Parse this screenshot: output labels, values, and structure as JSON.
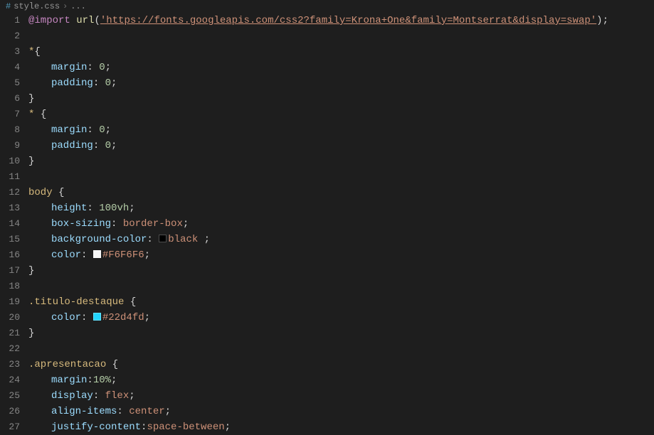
{
  "tab": {
    "filename": "style.css",
    "separator": "›",
    "crumb": "..."
  },
  "lines": [
    {
      "num": "1",
      "segments": [
        {
          "cls": "at-rule",
          "text": "@import"
        },
        {
          "cls": "",
          "text": " "
        },
        {
          "cls": "func",
          "text": "url"
        },
        {
          "cls": "punct",
          "text": "("
        },
        {
          "cls": "string url-underline",
          "text": "'https://fonts.googleapis.com/css2?family=Krona+One&family=Montserrat&display=swap'"
        },
        {
          "cls": "punct",
          "text": ")"
        },
        {
          "cls": "semi",
          "text": ";"
        }
      ]
    },
    {
      "num": "2",
      "segments": []
    },
    {
      "num": "3",
      "segments": [
        {
          "cls": "selector",
          "text": "*"
        },
        {
          "cls": "brace",
          "text": "{"
        }
      ]
    },
    {
      "num": "4",
      "indent": true,
      "segments": [
        {
          "cls": "prop",
          "text": "margin"
        },
        {
          "cls": "colon",
          "text": ": "
        },
        {
          "cls": "number",
          "text": "0"
        },
        {
          "cls": "semi",
          "text": ";"
        }
      ]
    },
    {
      "num": "5",
      "indent": true,
      "segments": [
        {
          "cls": "prop",
          "text": "padding"
        },
        {
          "cls": "colon",
          "text": ": "
        },
        {
          "cls": "number",
          "text": "0"
        },
        {
          "cls": "semi",
          "text": ";"
        }
      ]
    },
    {
      "num": "6",
      "segments": [
        {
          "cls": "brace",
          "text": "}"
        }
      ]
    },
    {
      "num": "7",
      "segments": [
        {
          "cls": "selector",
          "text": "*"
        },
        {
          "cls": "",
          "text": " "
        },
        {
          "cls": "brace",
          "text": "{"
        }
      ]
    },
    {
      "num": "8",
      "indent": true,
      "segments": [
        {
          "cls": "prop",
          "text": "margin"
        },
        {
          "cls": "colon",
          "text": ": "
        },
        {
          "cls": "number",
          "text": "0"
        },
        {
          "cls": "semi",
          "text": ";"
        }
      ]
    },
    {
      "num": "9",
      "indent": true,
      "segments": [
        {
          "cls": "prop",
          "text": "padding"
        },
        {
          "cls": "colon",
          "text": ": "
        },
        {
          "cls": "number",
          "text": "0"
        },
        {
          "cls": "semi",
          "text": ";"
        }
      ]
    },
    {
      "num": "10",
      "segments": [
        {
          "cls": "brace",
          "text": "}"
        }
      ]
    },
    {
      "num": "11",
      "segments": []
    },
    {
      "num": "12",
      "segments": [
        {
          "cls": "selector",
          "text": "body"
        },
        {
          "cls": "",
          "text": " "
        },
        {
          "cls": "brace",
          "text": "{"
        }
      ]
    },
    {
      "num": "13",
      "indent": true,
      "segments": [
        {
          "cls": "prop",
          "text": "height"
        },
        {
          "cls": "colon",
          "text": ": "
        },
        {
          "cls": "number",
          "text": "100vh"
        },
        {
          "cls": "semi",
          "text": ";"
        }
      ]
    },
    {
      "num": "14",
      "indent": true,
      "segments": [
        {
          "cls": "prop",
          "text": "box-sizing"
        },
        {
          "cls": "colon",
          "text": ": "
        },
        {
          "cls": "value",
          "text": "border-box"
        },
        {
          "cls": "semi",
          "text": ";"
        }
      ]
    },
    {
      "num": "15",
      "indent": true,
      "segments": [
        {
          "cls": "prop",
          "text": "background-color"
        },
        {
          "cls": "colon",
          "text": ": "
        },
        {
          "cls": "swatch swatch-black",
          "text": ""
        },
        {
          "cls": "value",
          "text": "black "
        },
        {
          "cls": "semi",
          "text": ";"
        }
      ]
    },
    {
      "num": "16",
      "indent": true,
      "segments": [
        {
          "cls": "prop",
          "text": "color"
        },
        {
          "cls": "colon",
          "text": ": "
        },
        {
          "cls": "swatch swatch-f6",
          "text": ""
        },
        {
          "cls": "value",
          "text": "#F6F6F6"
        },
        {
          "cls": "semi",
          "text": ";"
        }
      ]
    },
    {
      "num": "17",
      "segments": [
        {
          "cls": "brace",
          "text": "}"
        }
      ]
    },
    {
      "num": "18",
      "segments": []
    },
    {
      "num": "19",
      "segments": [
        {
          "cls": "selector",
          "text": ".titulo-destaque"
        },
        {
          "cls": "",
          "text": " "
        },
        {
          "cls": "brace",
          "text": "{"
        }
      ]
    },
    {
      "num": "20",
      "indent": true,
      "segments": [
        {
          "cls": "prop",
          "text": "color"
        },
        {
          "cls": "colon",
          "text": ": "
        },
        {
          "cls": "swatch swatch-22d4fd",
          "text": ""
        },
        {
          "cls": "value",
          "text": "#22d4fd"
        },
        {
          "cls": "semi",
          "text": ";"
        }
      ]
    },
    {
      "num": "21",
      "segments": [
        {
          "cls": "brace",
          "text": "}"
        }
      ]
    },
    {
      "num": "22",
      "segments": []
    },
    {
      "num": "23",
      "segments": [
        {
          "cls": "selector",
          "text": ".apresentacao"
        },
        {
          "cls": "",
          "text": " "
        },
        {
          "cls": "brace",
          "text": "{"
        }
      ]
    },
    {
      "num": "24",
      "indent": true,
      "segments": [
        {
          "cls": "prop",
          "text": "margin"
        },
        {
          "cls": "colon",
          "text": ":"
        },
        {
          "cls": "number",
          "text": "10%"
        },
        {
          "cls": "semi",
          "text": ";"
        }
      ]
    },
    {
      "num": "25",
      "indent": true,
      "segments": [
        {
          "cls": "prop",
          "text": "display"
        },
        {
          "cls": "colon",
          "text": ": "
        },
        {
          "cls": "value",
          "text": "flex"
        },
        {
          "cls": "semi",
          "text": ";"
        }
      ]
    },
    {
      "num": "26",
      "indent": true,
      "segments": [
        {
          "cls": "prop",
          "text": "align-items"
        },
        {
          "cls": "colon",
          "text": ": "
        },
        {
          "cls": "value",
          "text": "center"
        },
        {
          "cls": "semi",
          "text": ";"
        }
      ]
    },
    {
      "num": "27",
      "indent": true,
      "segments": [
        {
          "cls": "prop",
          "text": "justify-content"
        },
        {
          "cls": "colon",
          "text": ":"
        },
        {
          "cls": "value",
          "text": "space-between"
        },
        {
          "cls": "semi",
          "text": ";"
        }
      ]
    }
  ]
}
